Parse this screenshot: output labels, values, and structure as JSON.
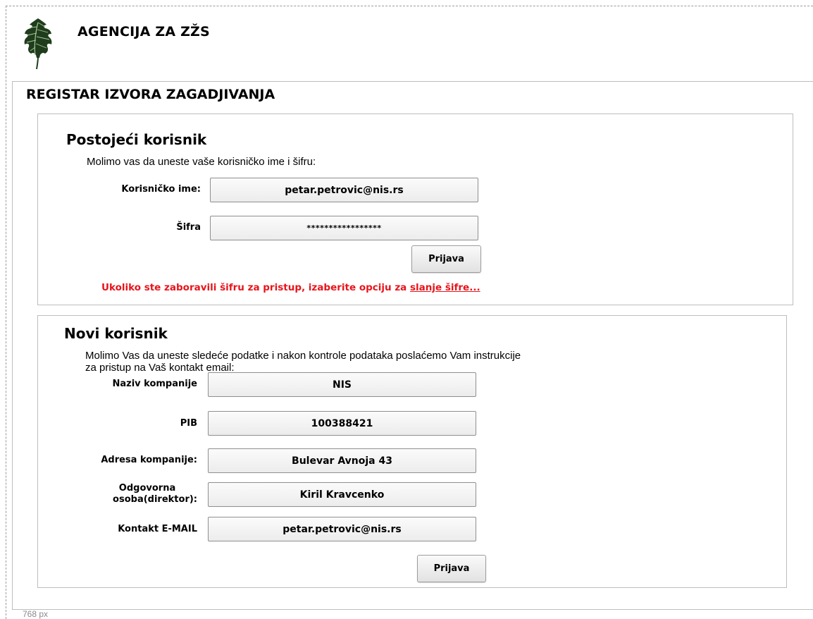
{
  "header": {
    "agency_title": "AGENCIJA ZA ZŽS",
    "logo_icon": "oak-leaf-icon"
  },
  "registry": {
    "title": "REGISTAR IZVORA ZAGADJIVANJA"
  },
  "existing_user": {
    "title": "Postojeći korisnik",
    "instruction": "Molimo vas da uneste vaše korisničko ime i šifru:",
    "username_label": "Korisničko ime:",
    "username_value": "petar.petrovic@nis.rs",
    "password_label": "Šifra",
    "password_value": "*****************",
    "login_button": "Prijava",
    "forgot_text": "Ukoliko ste zaboravili šifru za pristup, izaberite opciju za ",
    "forgot_link": "slanje šifre..."
  },
  "new_user": {
    "title": "Novi korisnik",
    "instruction_line1": "Molimo Vas da uneste sledeće podatke i nakon kontrole podataka poslaćemo Vam instrukcije",
    "instruction_line2": "za pristup na Vaš kontakt email:",
    "company_label": "Naziv kompanije",
    "company_value": "NIS",
    "pib_label": "PIB",
    "pib_value": "100388421",
    "address_label": "Adresa kompanije:",
    "address_value": "Bulevar Avnoja 43",
    "person_label_line1": "Odgovorna",
    "person_label_line2": "osoba(direktor):",
    "person_value": "Kiril Kravcenko",
    "email_label": "Kontakt E-MAIL",
    "email_value": "petar.petrovic@nis.rs",
    "submit_button": "Prijava"
  },
  "footer": {
    "width_note": "768 px"
  },
  "colors": {
    "link_red": "#e8141b",
    "leaf_dark": "#1f3d1c",
    "leaf_light": "#a8c89a"
  }
}
